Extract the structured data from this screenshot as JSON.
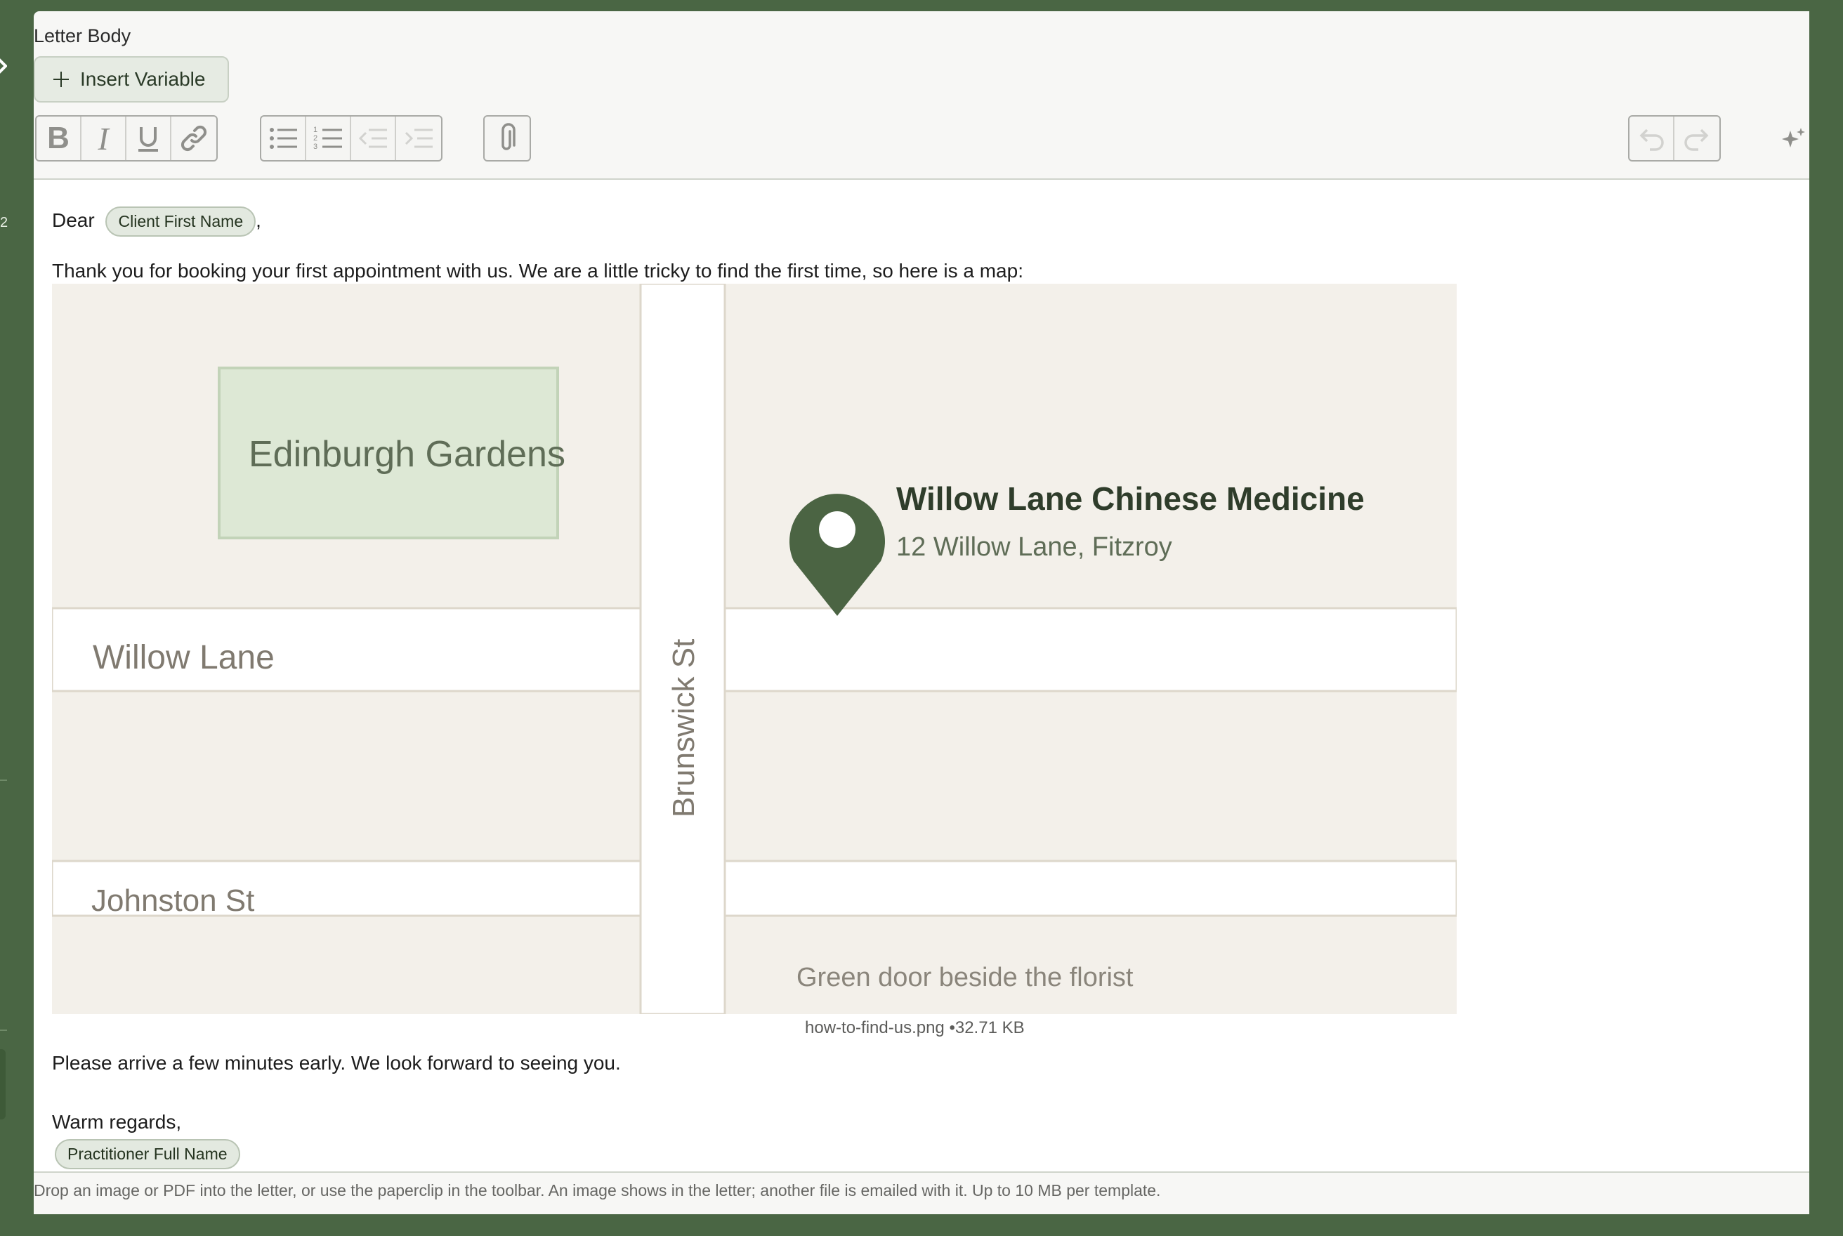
{
  "section_label": "Letter Body",
  "insert_variable_label": "Insert Variable",
  "toolbar": {
    "format": [
      "bold",
      "italic",
      "underline",
      "link"
    ],
    "lists": [
      "bullet-list",
      "numbered-list",
      "outdent",
      "indent"
    ],
    "attach": "paperclip",
    "history": [
      "undo",
      "redo"
    ],
    "ai": "sparkle"
  },
  "letter": {
    "greeting": "Dear",
    "greeting_var": "Client First Name",
    "greeting_comma": ",",
    "intro": "Thank you for booking your first appointment with us. We are a little tricky to find the first time, so here is a map:",
    "image_filename": "how-to-find-us.png",
    "image_size": "•32.71 KB",
    "closing_line": "Please arrive a few minutes early. We look forward to seeing you.",
    "signoff": "Warm regards,",
    "signoff_var": "Practitioner Full Name"
  },
  "map": {
    "park": "Edinburgh Gardens",
    "street_1": "Willow Lane",
    "street_2": "Brunswick St",
    "street_3": "Johnston St",
    "place_name": "Willow Lane Chinese Medicine",
    "place_address": "12 Willow Lane, Fitzroy",
    "note": "Green door beside the florist",
    "colors": {
      "land": "#f3f0ea",
      "road": "#ffffff",
      "park": "#dde8d5",
      "pin": "#4b6443"
    }
  },
  "help_text": "Drop an image or PDF into the letter, or use the paperclip in the toolbar. An image shows in the letter; another file is emailed with it. Up to 10 MB per template."
}
